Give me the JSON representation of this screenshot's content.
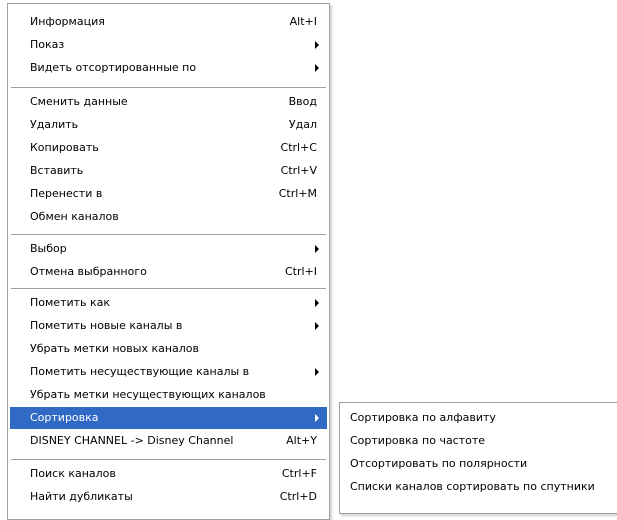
{
  "main_menu": {
    "items": [
      {
        "label": "Информация",
        "shortcut": "Alt+I"
      },
      {
        "label": "Показ"
      },
      {
        "label": "Видеть отсортированные по"
      },
      {
        "label": "Сменить данные",
        "shortcut": "Ввод"
      },
      {
        "label": "Удалить",
        "shortcut": "Удал"
      },
      {
        "label": "Копировать",
        "shortcut": "Ctrl+C"
      },
      {
        "label": "Вставить",
        "shortcut": "Ctrl+V"
      },
      {
        "label": "Перенести в",
        "shortcut": "Ctrl+M"
      },
      {
        "label": "Обмен каналов"
      },
      {
        "label": "Выбор"
      },
      {
        "label": "Отмена выбранного",
        "shortcut": "Ctrl+I"
      },
      {
        "label": "Пометить как"
      },
      {
        "label": "Пометить новые каналы в"
      },
      {
        "label": "Убрать метки новых каналов"
      },
      {
        "label": "Пометить несуществующие каналы в"
      },
      {
        "label": "Убрать метки несуществующих каналов"
      },
      {
        "label": "Сортировка"
      },
      {
        "label": "DISNEY CHANNEL -> Disney Channel",
        "shortcut": "Alt+Y"
      },
      {
        "label": "Поиск каналов",
        "shortcut": "Ctrl+F"
      },
      {
        "label": "Найти дубликаты",
        "shortcut": "Ctrl+D"
      }
    ]
  },
  "sub_menu": {
    "items": [
      {
        "label": "Сортировка по алфавиту"
      },
      {
        "label": "Сортировка по частоте"
      },
      {
        "label": "Отсортировать по полярности"
      },
      {
        "label": "Списки каналов сортировать по спутники"
      }
    ]
  },
  "colors": {
    "highlight": "#316ac5",
    "border": "#a0a0a0",
    "background": "#ffffff"
  }
}
